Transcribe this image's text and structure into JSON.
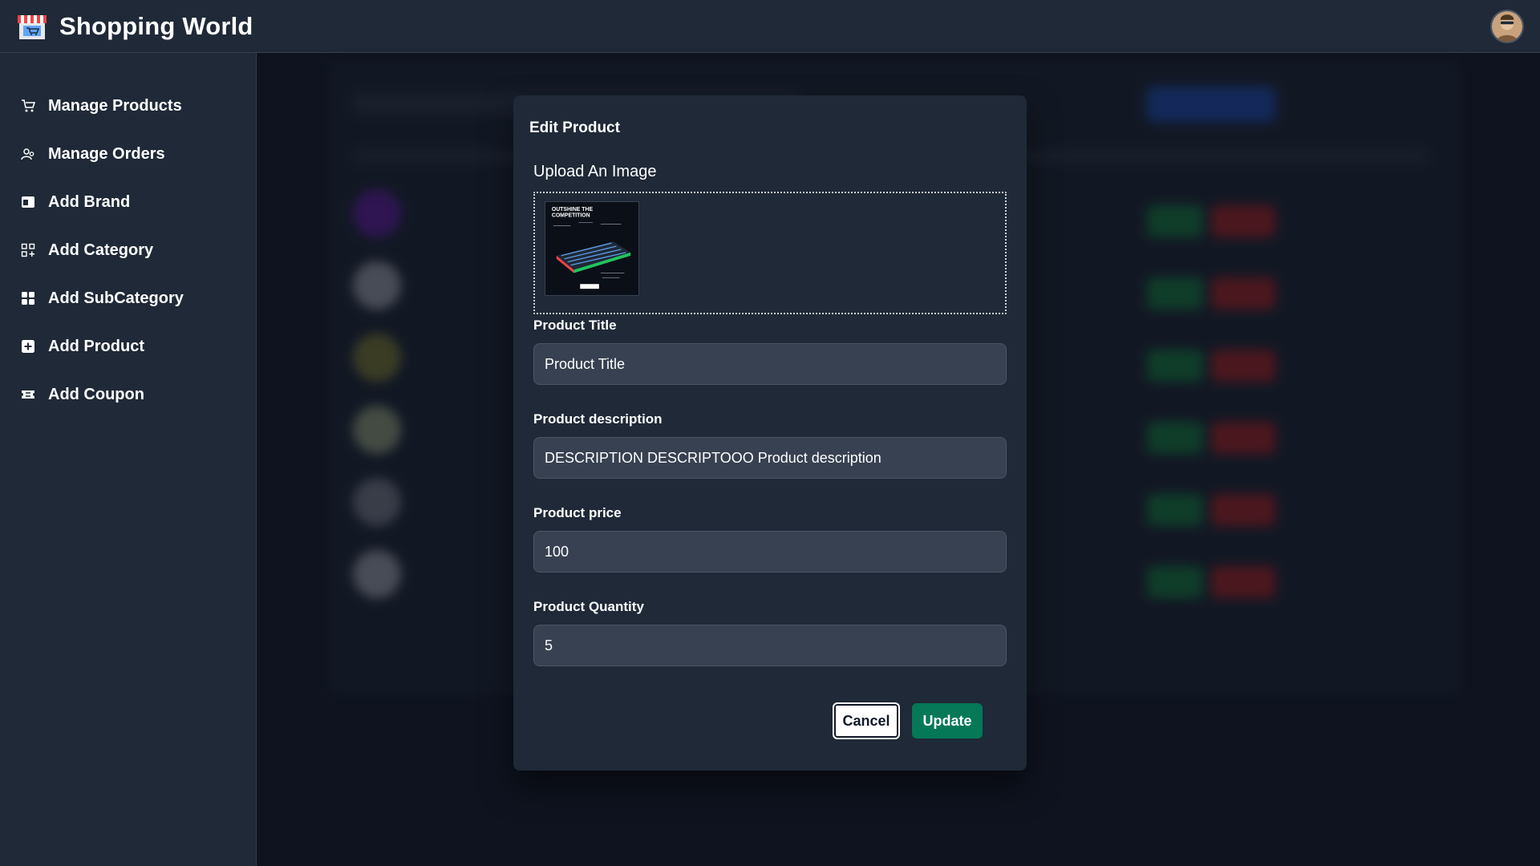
{
  "app": {
    "name": "Shopping World"
  },
  "sidebar": {
    "items": [
      {
        "label": "Manage Products",
        "icon": "cart-icon"
      },
      {
        "label": "Manage Orders",
        "icon": "users-icon"
      },
      {
        "label": "Add Brand",
        "icon": "window-icon"
      },
      {
        "label": "Add Category",
        "icon": "grid-plus-icon"
      },
      {
        "label": "Add SubCategory",
        "icon": "grid-icon"
      },
      {
        "label": "Add Product",
        "icon": "plus-square-icon"
      },
      {
        "label": "Add Coupon",
        "icon": "ticket-icon"
      }
    ]
  },
  "modal": {
    "title": "Edit Product",
    "upload_label": "Upload An Image",
    "preview_text": {
      "headline_1": "OUTSHINE THE",
      "headline_2": "COMPETITION"
    },
    "fields": {
      "title": {
        "label": "Product Title",
        "value": "",
        "placeholder": "Product Title"
      },
      "description": {
        "label": "Product description",
        "value": "DESCRIPTION DESCRIPTOOO Product description",
        "placeholder": ""
      },
      "price": {
        "label": "Product price",
        "value": "100",
        "placeholder": ""
      },
      "quantity": {
        "label": "Product Quantity",
        "value": "5",
        "placeholder": ""
      }
    },
    "buttons": {
      "cancel": "Cancel",
      "update": "Update"
    }
  },
  "colors": {
    "page_bg": "#111827",
    "panel_bg": "#1f2937",
    "input_bg": "#374151",
    "update_button": "#047857",
    "bg_green": "#16a34a",
    "bg_red": "#dc2626",
    "bg_blue": "#2563eb"
  }
}
